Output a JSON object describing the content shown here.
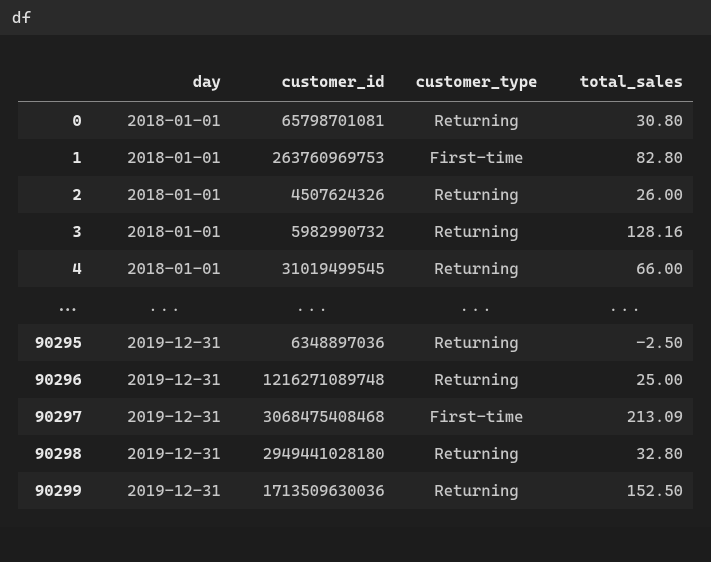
{
  "input": {
    "code": "df"
  },
  "table": {
    "columns": [
      "",
      "day",
      "customer_id",
      "customer_type",
      "total_sales"
    ],
    "top_rows": [
      {
        "idx": "0",
        "day": "2018-01-01",
        "customer_id": "65798701081",
        "customer_type": "Returning",
        "total_sales": "30.80"
      },
      {
        "idx": "1",
        "day": "2018-01-01",
        "customer_id": "263760969753",
        "customer_type": "First-time",
        "total_sales": "82.80"
      },
      {
        "idx": "2",
        "day": "2018-01-01",
        "customer_id": "4507624326",
        "customer_type": "Returning",
        "total_sales": "26.00"
      },
      {
        "idx": "3",
        "day": "2018-01-01",
        "customer_id": "5982990732",
        "customer_type": "Returning",
        "total_sales": "128.16"
      },
      {
        "idx": "4",
        "day": "2018-01-01",
        "customer_id": "31019499545",
        "customer_type": "Returning",
        "total_sales": "66.00"
      }
    ],
    "ellipsis": "...",
    "bottom_rows": [
      {
        "idx": "90295",
        "day": "2019-12-31",
        "customer_id": "6348897036",
        "customer_type": "Returning",
        "total_sales": "-2.50"
      },
      {
        "idx": "90296",
        "day": "2019-12-31",
        "customer_id": "1216271089748",
        "customer_type": "Returning",
        "total_sales": "25.00"
      },
      {
        "idx": "90297",
        "day": "2019-12-31",
        "customer_id": "3068475408468",
        "customer_type": "First-time",
        "total_sales": "213.09"
      },
      {
        "idx": "90298",
        "day": "2019-12-31",
        "customer_id": "2949441028180",
        "customer_type": "Returning",
        "total_sales": "32.80"
      },
      {
        "idx": "90299",
        "day": "2019-12-31",
        "customer_id": "1713509630036",
        "customer_type": "Returning",
        "total_sales": "152.50"
      }
    ]
  }
}
